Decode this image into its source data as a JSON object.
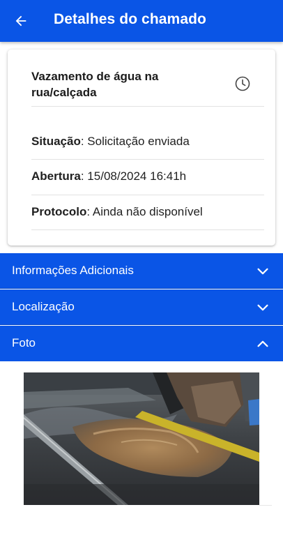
{
  "app_bar": {
    "title": "Detalhes do chamado",
    "back_icon": "arrow-left-icon",
    "background": "#0a55e6"
  },
  "card": {
    "title": "Vazamento de água na rua/calçada",
    "status_icon": "clock-icon",
    "fields": [
      {
        "label": "Situação",
        "value": ": Solicitação enviada"
      },
      {
        "label": "Abertura",
        "value": ": 15/08/2024 16:41h"
      },
      {
        "label": "Protocolo",
        "value": ": Ainda não disponível"
      }
    ]
  },
  "sections": [
    {
      "label": "Informações Adicionais",
      "icon": "chevron-down-icon",
      "expanded": false
    },
    {
      "label": "Localização",
      "icon": "chevron-down-icon",
      "expanded": false
    },
    {
      "label": "Foto",
      "icon": "chevron-up-icon",
      "expanded": true
    }
  ],
  "colors": {
    "primary": "#0a55e6",
    "on_primary": "#ffffff",
    "text": "#1a1a1a",
    "divider": "#e2e2e2"
  }
}
